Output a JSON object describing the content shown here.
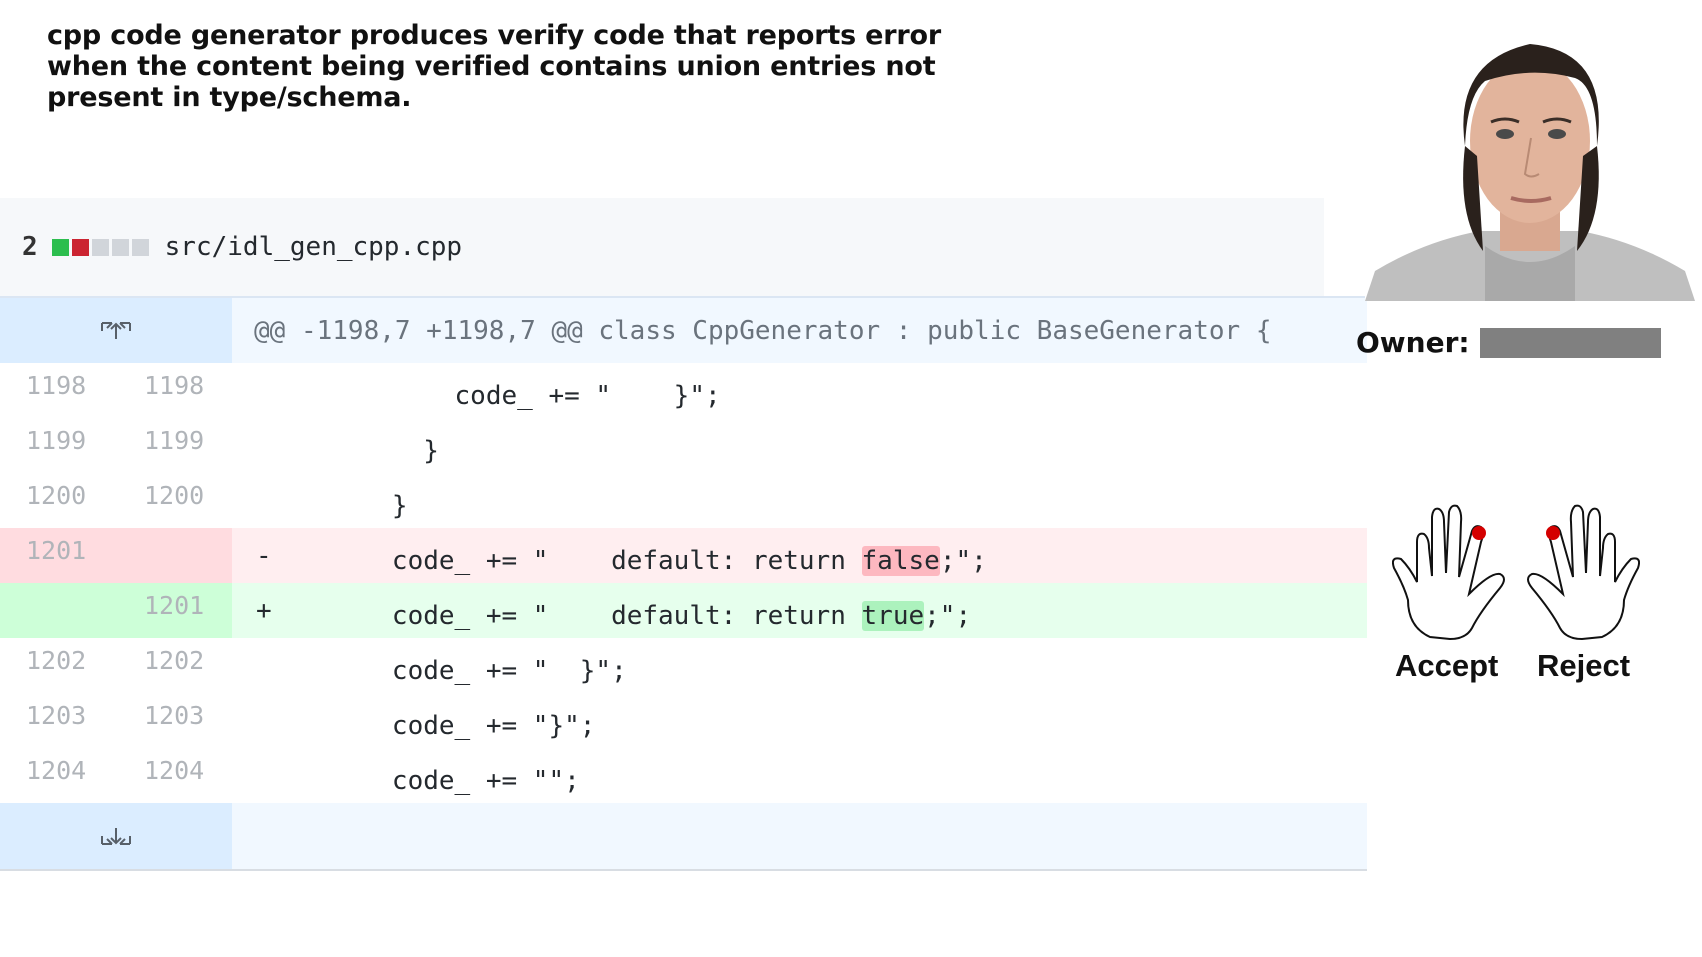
{
  "headline": "cpp code generator produces verify code that reports error when the content being verified contains union entries not present in type/schema.",
  "file": {
    "change_count": "2",
    "diffstat": [
      "#2cbe4e",
      "#cb2431",
      "#d1d5da",
      "#d1d5da",
      "#d1d5da"
    ],
    "filename": "src/idl_gen_cpp.cpp"
  },
  "hunk": {
    "header": "@@ -1198,7 +1198,7 @@ class CppGenerator : public BaseGenerator {",
    "expand_up_icon": "expand-up-icon",
    "expand_down_icon": "expand-down-icon"
  },
  "lines": [
    {
      "old": "1198",
      "new": "1198",
      "marker": "",
      "code": "          code_ += \"    }\";"
    },
    {
      "old": "1199",
      "new": "1199",
      "marker": "",
      "code": "        }"
    },
    {
      "old": "1200",
      "new": "1200",
      "marker": "",
      "code": "      }"
    },
    {
      "old": "1201",
      "new": "",
      "marker": "-",
      "pre": "      code_ += \"    default: return ",
      "hl": "false",
      "post": ";\";"
    },
    {
      "old": "",
      "new": "1201",
      "marker": "+",
      "pre": "      code_ += \"    default: return ",
      "hl": "true",
      "post": ";\";"
    },
    {
      "old": "1202",
      "new": "1202",
      "marker": "",
      "code": "      code_ += \"  }\";"
    },
    {
      "old": "1203",
      "new": "1203",
      "marker": "",
      "code": "      code_ += \"}\";"
    },
    {
      "old": "1204",
      "new": "1204",
      "marker": "",
      "code": "      code_ += \"\";"
    }
  ],
  "owner": {
    "label": "Owner:"
  },
  "actions": {
    "accept": "Accept",
    "reject": "Reject"
  }
}
